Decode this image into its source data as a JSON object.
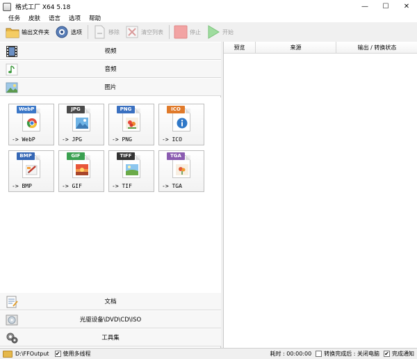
{
  "window": {
    "title": "格式工厂 X64 5.18",
    "minimize": "—",
    "maximize": "☐",
    "close": "✕"
  },
  "menu": [
    "任务",
    "皮肤",
    "语言",
    "选项",
    "帮助"
  ],
  "toolbar": {
    "output_folder": "输出文件夹",
    "options": "选项",
    "remove": "移除",
    "clear_list": "清空列表",
    "stop": "停止",
    "start": "开始"
  },
  "categories": {
    "video": "视频",
    "audio": "音频",
    "image": "图片",
    "document": "文档",
    "rom": "光驱设备\\DVD\\CD\\ISO",
    "toolbox": "工具集"
  },
  "formats": [
    {
      "badge": "WebP",
      "label": "-> WebP",
      "badge_color": "#3c78c8",
      "icon": "chrome-webp-icon"
    },
    {
      "badge": "JPG",
      "label": "-> JPG",
      "badge_color": "#4a4a4a",
      "icon": "landscape-photo-icon"
    },
    {
      "badge": "PNG",
      "label": "-> PNG",
      "badge_color": "#3a70c0",
      "icon": "flower-picture-icon"
    },
    {
      "badge": "ICO",
      "label": "-> ICO",
      "badge_color": "#e07a2a",
      "icon": "info-icon"
    },
    {
      "badge": "BMP",
      "label": "-> BMP",
      "badge_color": "#3567b5",
      "icon": "paint-brush-icon"
    },
    {
      "badge": "GIF",
      "label": "-> GIF",
      "badge_color": "#3aa050",
      "icon": "sunset-picture-icon"
    },
    {
      "badge": "TIFF",
      "label": "-> TIF",
      "badge_color": "#333333",
      "icon": "landscape-picture-icon"
    },
    {
      "badge": "TGA",
      "label": "-> TGA",
      "badge_color": "#8a5bb0",
      "icon": "flower-picture-icon"
    }
  ],
  "table": {
    "headers": [
      "预览",
      "来源",
      "输出 / 转换状态"
    ]
  },
  "status": {
    "output_path": "D:\\FFOutput",
    "multithread": "使用多线程",
    "elapsed": "耗时 : 00:00:00",
    "after_convert": "转换完成后 : 关闭电脑",
    "notify": "完成通知"
  }
}
